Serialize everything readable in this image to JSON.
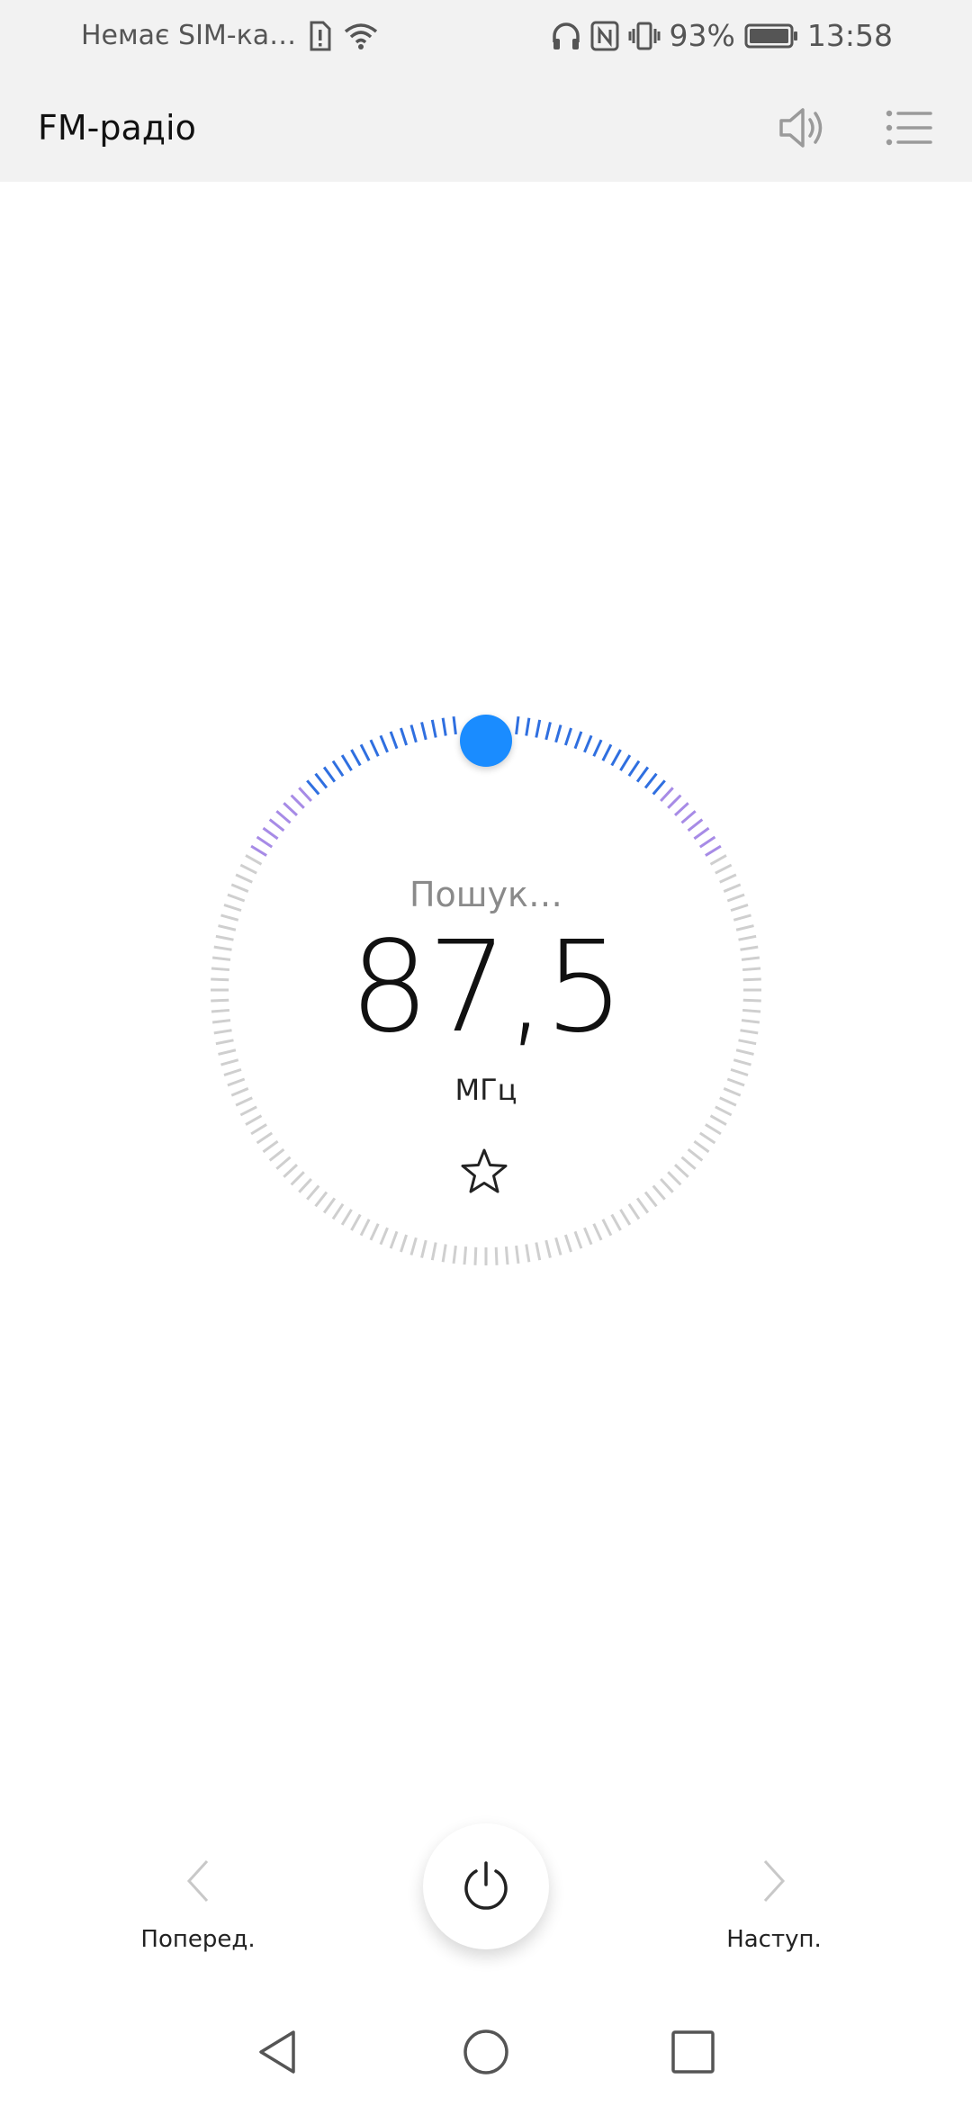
{
  "status_bar": {
    "carrier": "Немає SIM-ка…",
    "battery": "93%",
    "time": "13:58",
    "icons": [
      "sim-alert-icon",
      "wifi-icon",
      "headphones-icon",
      "nfc-icon",
      "vibrate-icon",
      "battery-icon"
    ]
  },
  "app_bar": {
    "title": "FM-радіо",
    "actions": [
      "speaker-icon",
      "station-list-icon"
    ]
  },
  "tuner": {
    "status": "Пошук…",
    "frequency": "87,5",
    "unit": "МГц",
    "favorite_icon": "star-outline-icon",
    "colors": {
      "knob": "#1a8cff",
      "active_ticks": "#2f6fe0",
      "accent_ticks": "#a78be6",
      "inactive_ticks": "#cfcfcf"
    }
  },
  "controls": {
    "prev_label": "Поперед.",
    "next_label": "Наступ.",
    "power_icon": "power-icon"
  },
  "system_nav": [
    "back-icon",
    "home-icon",
    "recents-icon"
  ]
}
